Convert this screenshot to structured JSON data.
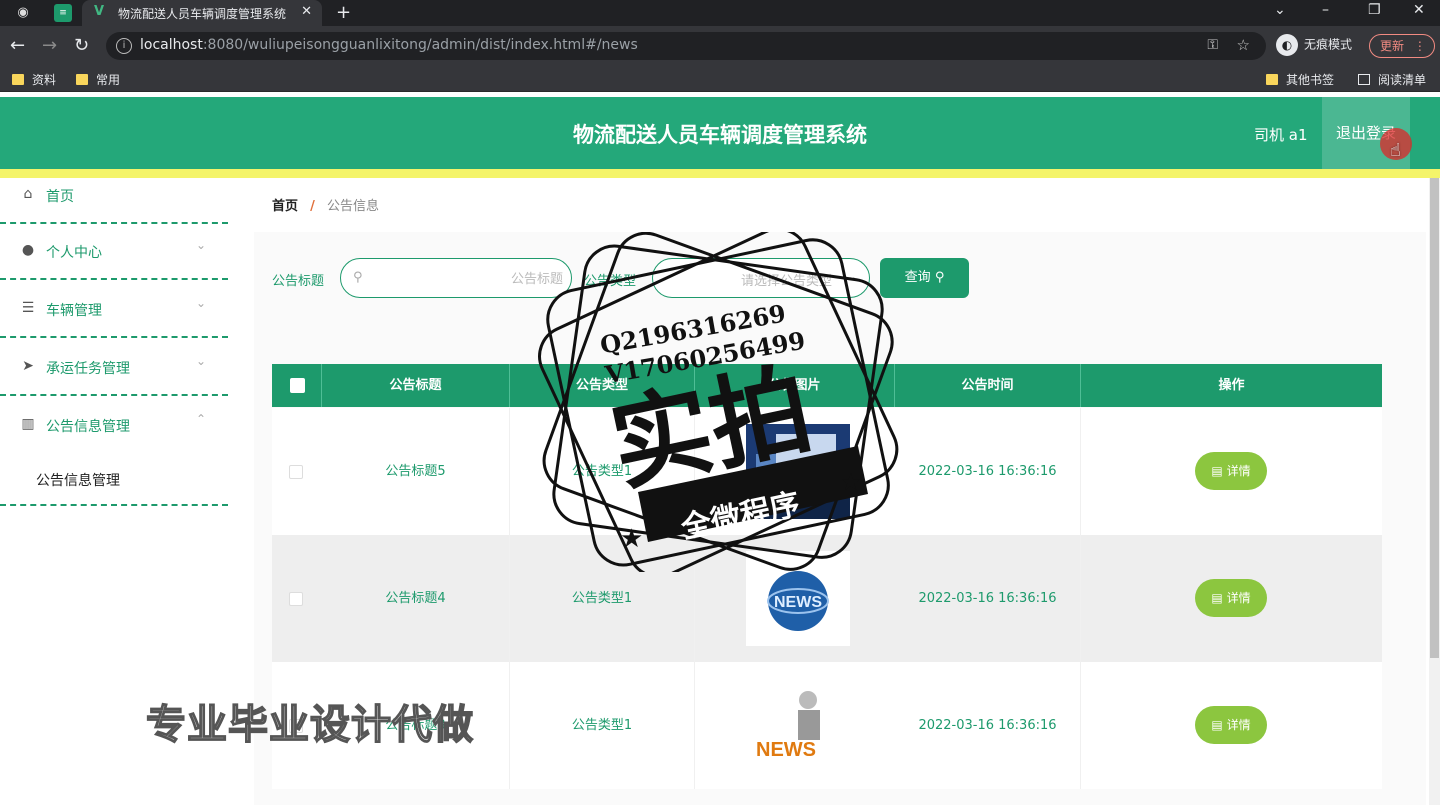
{
  "browser": {
    "tab_title": "物流配送人员车辆调度管理系统",
    "url_host": "localhost",
    "url_rest": ":8080/wuliupeisongguanlixitong/admin/dist/index.html#/news",
    "incognito_label": "无痕模式",
    "update_label": "更新",
    "bookmarks": [
      "资料",
      "常用"
    ],
    "other_bookmarks": "其他书签",
    "reading_list": "阅读清单"
  },
  "header": {
    "title": "物流配送人员车辆调度管理系统",
    "user": "司机 a1",
    "logout": "退出登录"
  },
  "sidebar": {
    "items": [
      {
        "label": "首页",
        "icon": "home-icon"
      },
      {
        "label": "个人中心",
        "icon": "user-icon"
      },
      {
        "label": "车辆管理",
        "icon": "list-icon"
      },
      {
        "label": "承运任务管理",
        "icon": "send-icon"
      },
      {
        "label": "公告信息管理",
        "icon": "book-icon"
      }
    ],
    "submenu": "公告信息管理"
  },
  "breadcrumb": {
    "home": "首页",
    "separator": "/",
    "current": "公告信息"
  },
  "search": {
    "title_label": "公告标题",
    "title_placeholder": "公告标题",
    "type_label": "公告类型",
    "type_placeholder": "请选择公告类型",
    "query_button": "查询"
  },
  "table": {
    "headers": [
      "公告标题",
      "公告类型",
      "公告图片",
      "公告时间",
      "操作"
    ],
    "rows": [
      {
        "title": "公告标题5",
        "type": "公告类型1",
        "time": "2022-03-16 16:36:16",
        "action": "详情"
      },
      {
        "title": "公告标题4",
        "type": "公告类型1",
        "time": "2022-03-16 16:36:16",
        "action": "详情"
      },
      {
        "title": "公告标题3",
        "type": "公告类型1",
        "time": "2022-03-16 16:36:16",
        "action": "详情"
      }
    ]
  },
  "watermark": {
    "qq": "Q2196316269",
    "v": "V17060256499",
    "big": "实拍",
    "ribbon": "全微程序",
    "bottom": "专业毕业设计代做"
  },
  "colors": {
    "primary": "#1d9a6c",
    "header": "#24a87a",
    "accent_bar": "#f4f46a",
    "detail_button": "#8cc63f"
  }
}
